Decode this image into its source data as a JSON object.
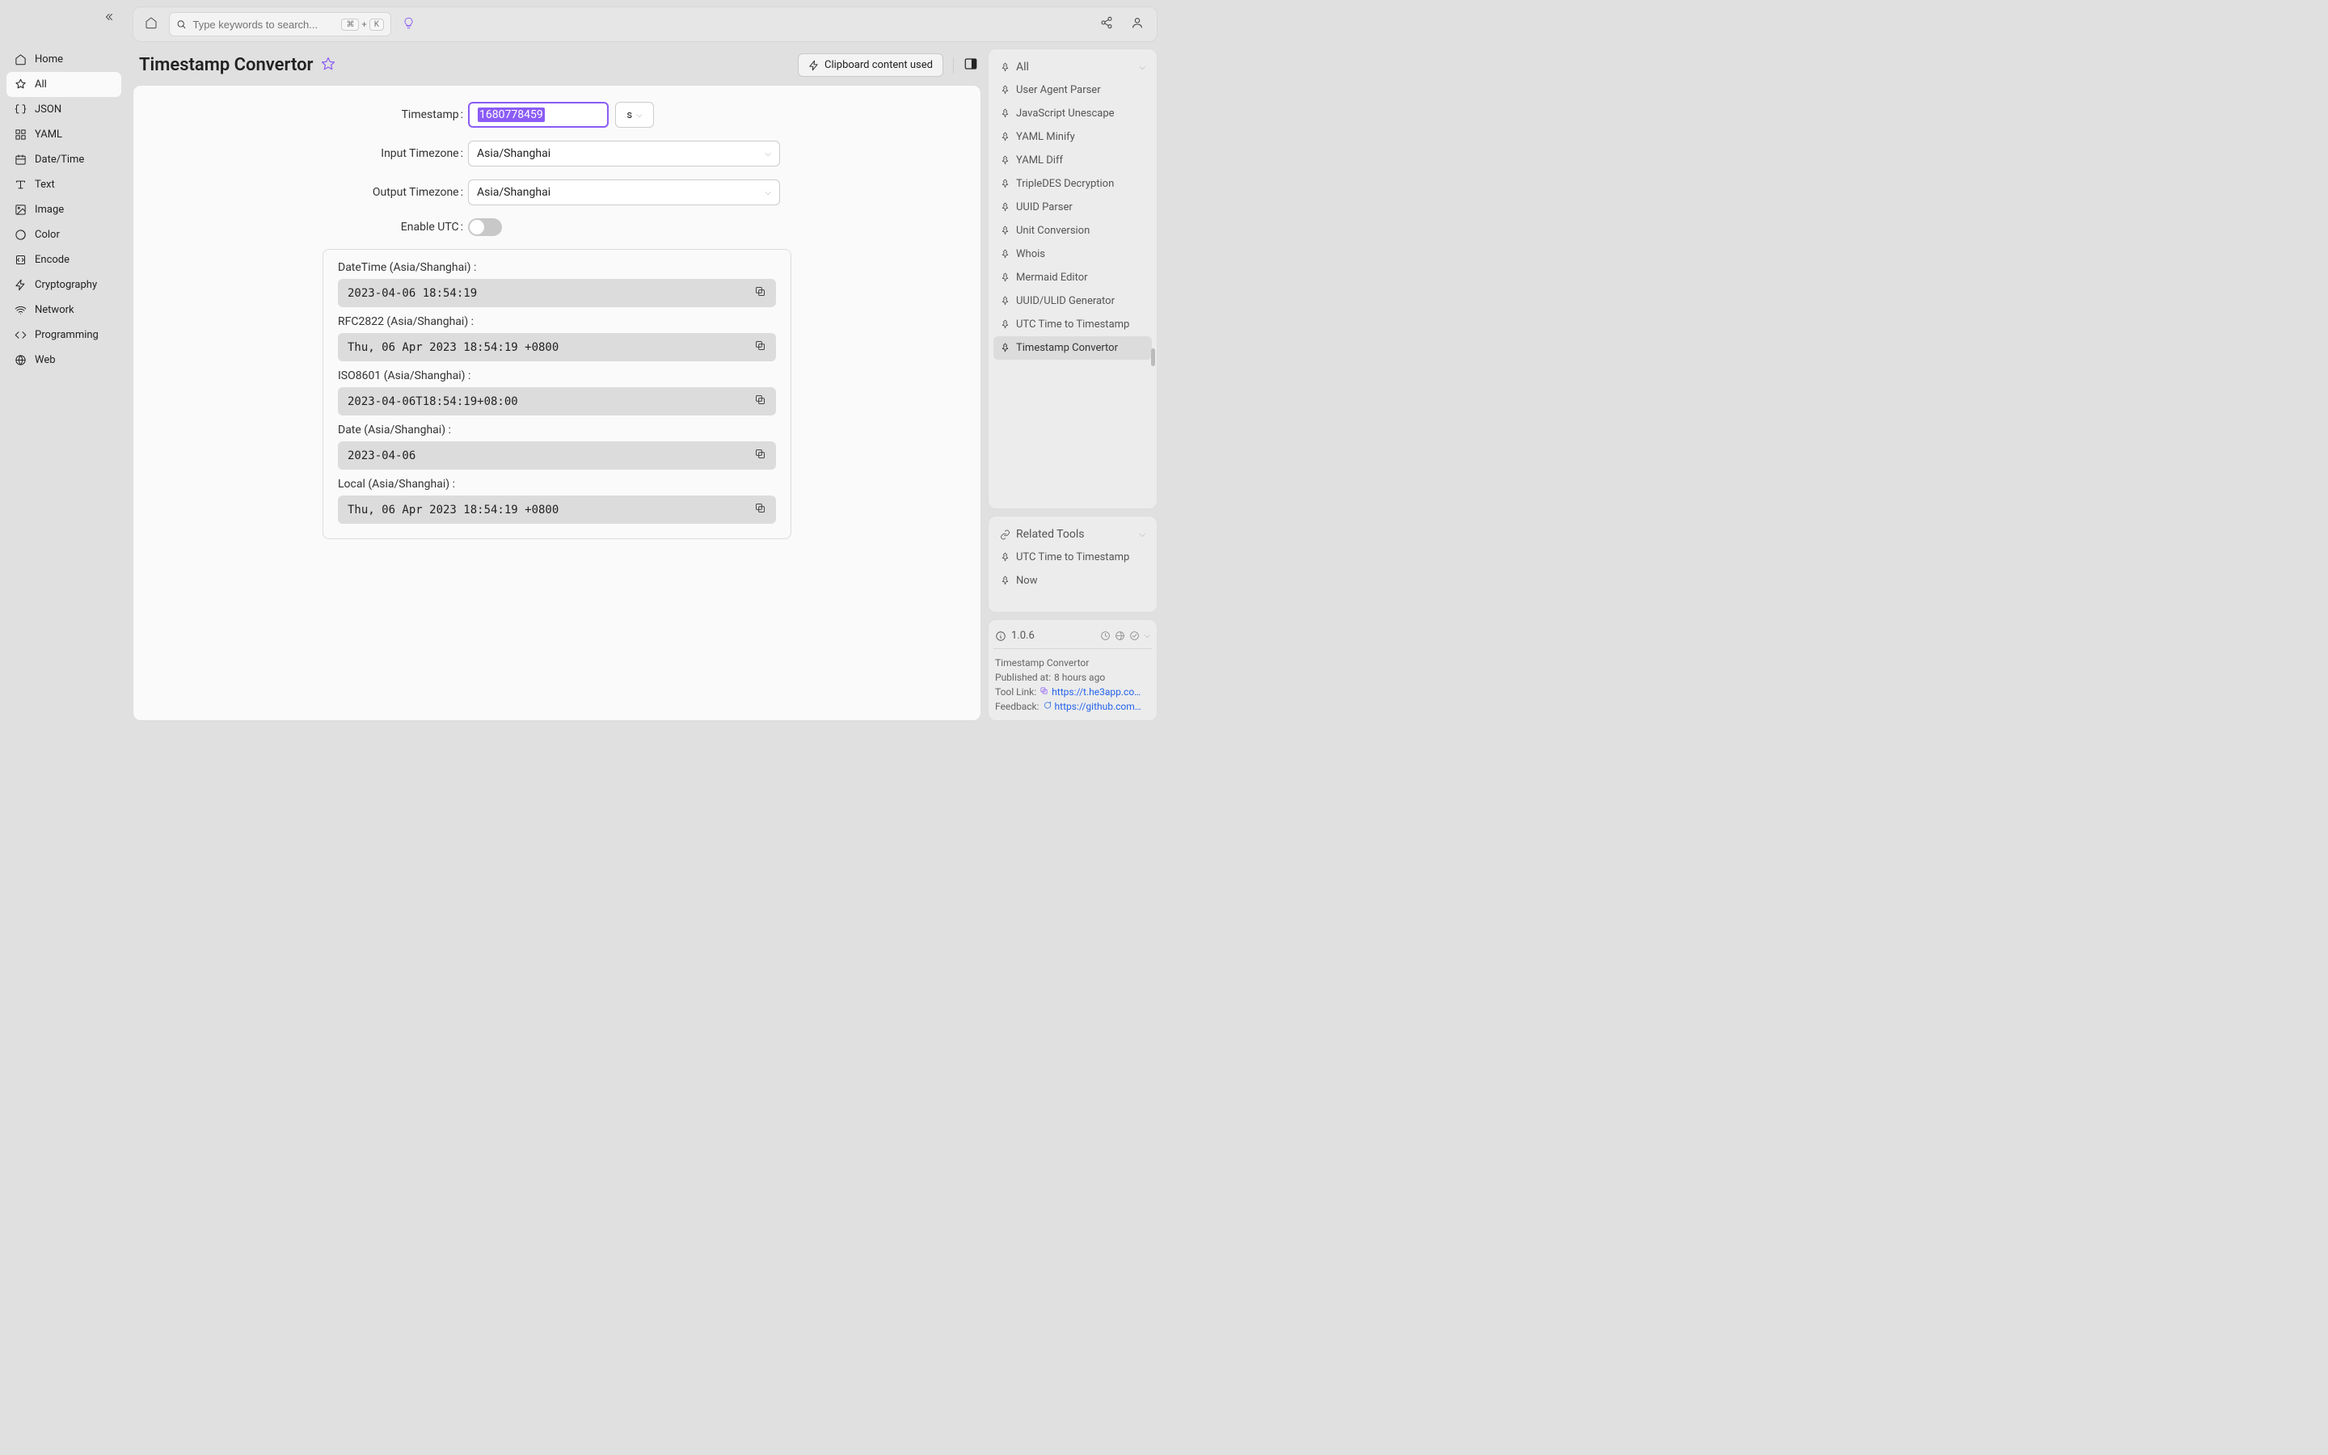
{
  "search": {
    "placeholder": "Type keywords to search...",
    "kbd1": "⌘",
    "kbdplus": "+",
    "kbd2": "K"
  },
  "sidebar": {
    "items": [
      {
        "label": "Home"
      },
      {
        "label": "All"
      },
      {
        "label": "JSON"
      },
      {
        "label": "YAML"
      },
      {
        "label": "Date/Time"
      },
      {
        "label": "Text"
      },
      {
        "label": "Image"
      },
      {
        "label": "Color"
      },
      {
        "label": "Encode"
      },
      {
        "label": "Cryptography"
      },
      {
        "label": "Network"
      },
      {
        "label": "Programming"
      },
      {
        "label": "Web"
      }
    ]
  },
  "page": {
    "title": "Timestamp Convertor",
    "clipboard_btn": "Clipboard content used"
  },
  "form": {
    "timestamp_label": "Timestamp",
    "timestamp_value": "1680778459",
    "unit": "s",
    "input_tz_label": "Input Timezone",
    "input_tz_value": "Asia/Shanghai",
    "output_tz_label": "Output Timezone",
    "output_tz_value": "Asia/Shanghai",
    "enable_utc_label": "Enable UTC"
  },
  "results": [
    {
      "label": "DateTime (Asia/Shanghai) :",
      "value": "2023-04-06 18:54:19"
    },
    {
      "label": "RFC2822 (Asia/Shanghai) :",
      "value": "Thu, 06 Apr 2023 18:54:19 +0800"
    },
    {
      "label": "ISO8601 (Asia/Shanghai) :",
      "value": "2023-04-06T18:54:19+08:00"
    },
    {
      "label": "Date (Asia/Shanghai) :",
      "value": "2023-04-06"
    },
    {
      "label": "Local (Asia/Shanghai) :",
      "value": "Thu, 06 Apr 2023 18:54:19 +0800"
    }
  ],
  "right": {
    "all_header": "All",
    "tools": [
      "User Agent Parser",
      "JavaScript Unescape",
      "YAML Minify",
      "YAML Diff",
      "TripleDES Decryption",
      "UUID Parser",
      "Unit Conversion",
      "Whois",
      "Mermaid Editor",
      "UUID/ULID Generator",
      "UTC Time to Timestamp",
      "Timestamp Convertor"
    ],
    "related_header": "Related Tools",
    "related": [
      "UTC Time to Timestamp",
      "Now"
    ],
    "version": "1.0.6",
    "info_title": "Timestamp Convertor",
    "published_label": "Published at:",
    "published_value": "8 hours ago",
    "toollink_label": "Tool Link:",
    "toollink_value": "https://t.he3app.co…",
    "feedback_label": "Feedback:",
    "feedback_value": "https://github.com/…"
  }
}
